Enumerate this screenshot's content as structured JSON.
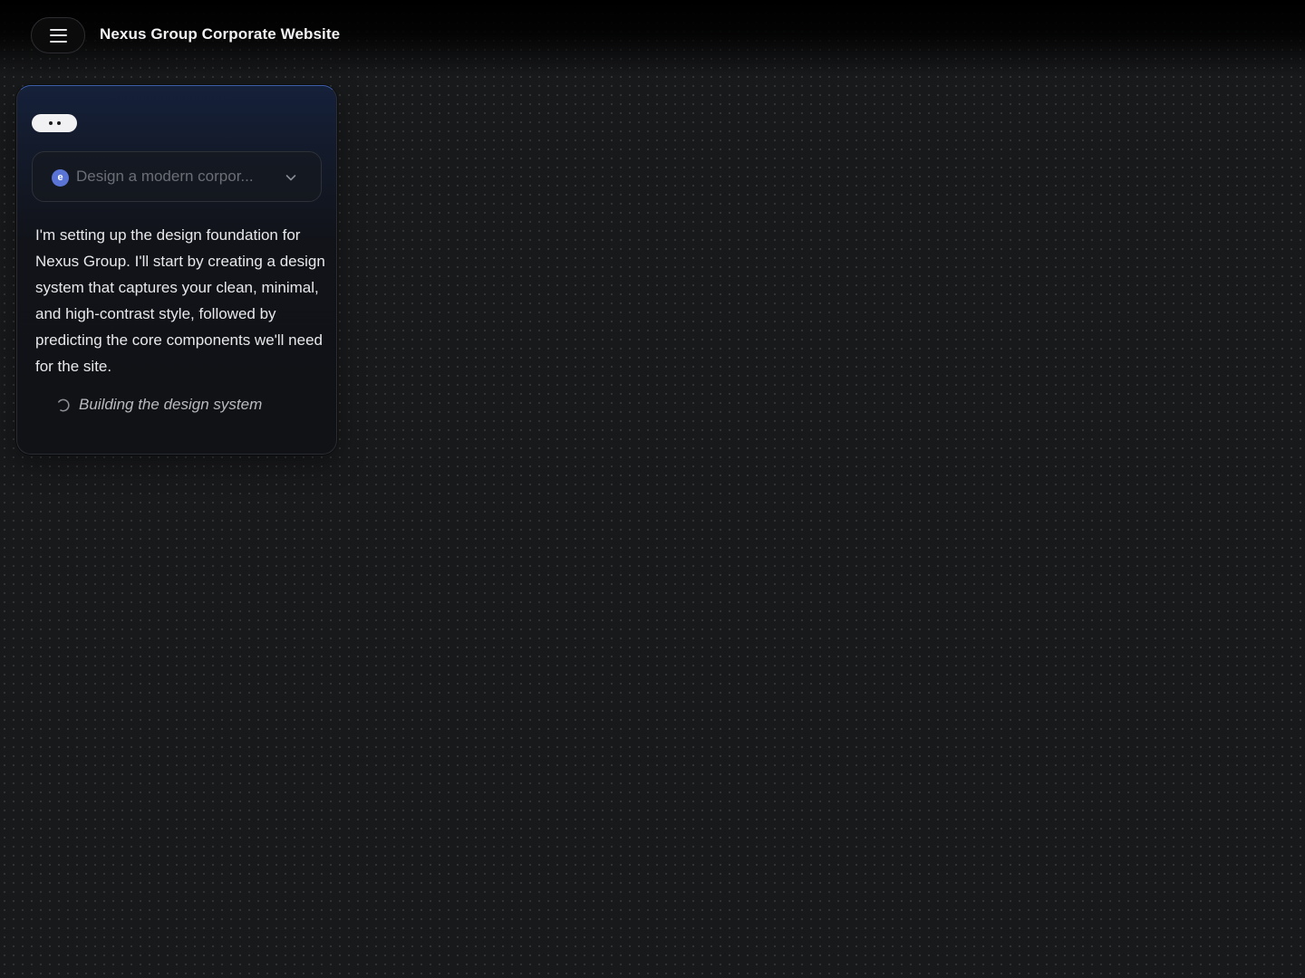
{
  "header": {
    "menu_icon": "hamburger-menu-icon",
    "title": "Nexus Group Corporate Website"
  },
  "chat": {
    "typing_indicator_icon": "ellipsis-icon",
    "prompt": {
      "avatar_letter": "e",
      "text": "Design a modern corpor...",
      "expand_icon": "chevron-down-icon"
    },
    "message": "I'm setting up the design foundation for Nexus Group. I'll start by creating a design system that captures your clean, minimal, and high-contrast style, followed by predicting the core components we'll need for the site.",
    "status": {
      "icon": "spinner-icon",
      "text": "Building the design system"
    }
  },
  "colors": {
    "background": "#18191b",
    "card_accent": "#3c5fa8",
    "avatar": "#5a74d6"
  }
}
